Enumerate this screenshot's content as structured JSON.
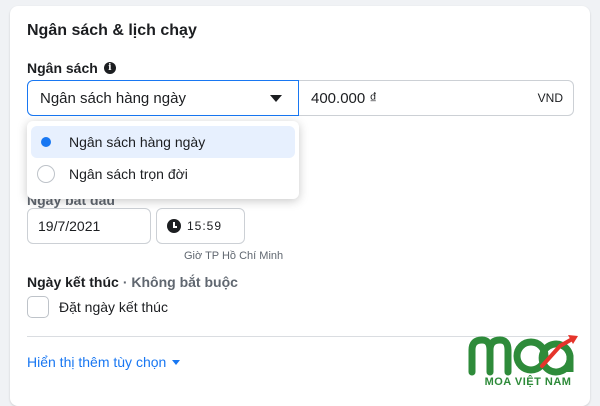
{
  "section": {
    "title": "Ngân sách & lịch chạy"
  },
  "budget": {
    "label": "Ngân sách",
    "info_icon": "info-icon",
    "selected_type": "Ngân sách hàng ngày",
    "amount": "400.000 ₫",
    "currency": "VND",
    "options": [
      {
        "label": "Ngân sách hàng ngày",
        "selected": true
      },
      {
        "label": "Ngân sách trọn đời",
        "selected": false
      }
    ]
  },
  "start": {
    "label": "Ngày bắt đầu",
    "date": "19/7/2021",
    "time": "15:59",
    "timezone": "Giờ TP Hồ Chí Minh"
  },
  "end": {
    "label": "Ngày kết thúc",
    "optional": "· Không bắt buộc",
    "checkbox_label": "Đặt ngày kết thúc"
  },
  "more_options": "Hiển thị thêm tùy chọn",
  "watermark": {
    "text": "MOA VIỆT NAM"
  },
  "colors": {
    "accent": "#1877f2",
    "logo_green": "#2e8b3a",
    "logo_red": "#e5342b"
  }
}
